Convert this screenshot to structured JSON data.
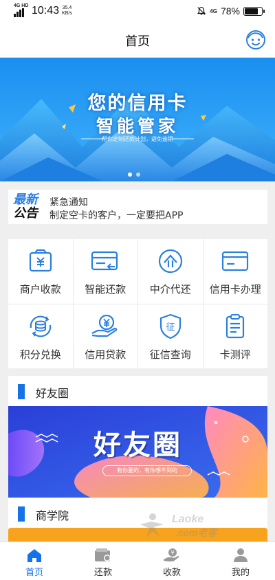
{
  "status_bar": {
    "network_label": "4G HD",
    "time": "10:43",
    "speed_value": "35.4",
    "speed_unit": "KB/s",
    "net_small": "4G",
    "battery_text": "78%",
    "battery_level": 0.78
  },
  "header": {
    "title": "首页",
    "avatar_icon": "smiley-face-icon"
  },
  "banner": {
    "title": "您的信用卡",
    "subtitle": "智能管家",
    "tagline": "帮你定制还款计划，避免逾期",
    "slide_count": 2,
    "active_slide": 1
  },
  "notice": {
    "badge_line1": "最新",
    "badge_line2": "公告",
    "title": "紧急通知",
    "body": "制定空卡的客户，一定要把APP"
  },
  "services": [
    {
      "label": "商户收款",
      "icon": "cash-register-icon"
    },
    {
      "label": "智能还款",
      "icon": "card-refund-icon"
    },
    {
      "label": "中介代还",
      "icon": "agent-icon"
    },
    {
      "label": "信用卡办理",
      "icon": "credit-card-icon"
    },
    {
      "label": "积分兑换",
      "icon": "points-exchange-icon"
    },
    {
      "label": "信用贷款",
      "icon": "loan-hand-icon"
    },
    {
      "label": "征信查询",
      "icon": "credit-shield-icon"
    },
    {
      "label": "卡测评",
      "icon": "clipboard-icon"
    }
  ],
  "friends": {
    "section_title": "好友圈",
    "banner_title": "好友圈",
    "banner_tagline": "有你要的，有你想不到的"
  },
  "academy": {
    "section_title": "商学院"
  },
  "watermark": {
    "line1": "Laoke",
    "line2": ".com老客"
  },
  "tabs": [
    {
      "label": "首页",
      "icon": "home-icon",
      "active": true
    },
    {
      "label": "还款",
      "icon": "wallet-icon",
      "active": false
    },
    {
      "label": "收款",
      "icon": "money-hand-icon",
      "active": false
    },
    {
      "label": "我的",
      "icon": "user-icon",
      "active": false
    }
  ],
  "colors": {
    "accent": "#1572e8",
    "icon_blue": "#2a7fe0",
    "strip_orange": "#f8a31d"
  }
}
